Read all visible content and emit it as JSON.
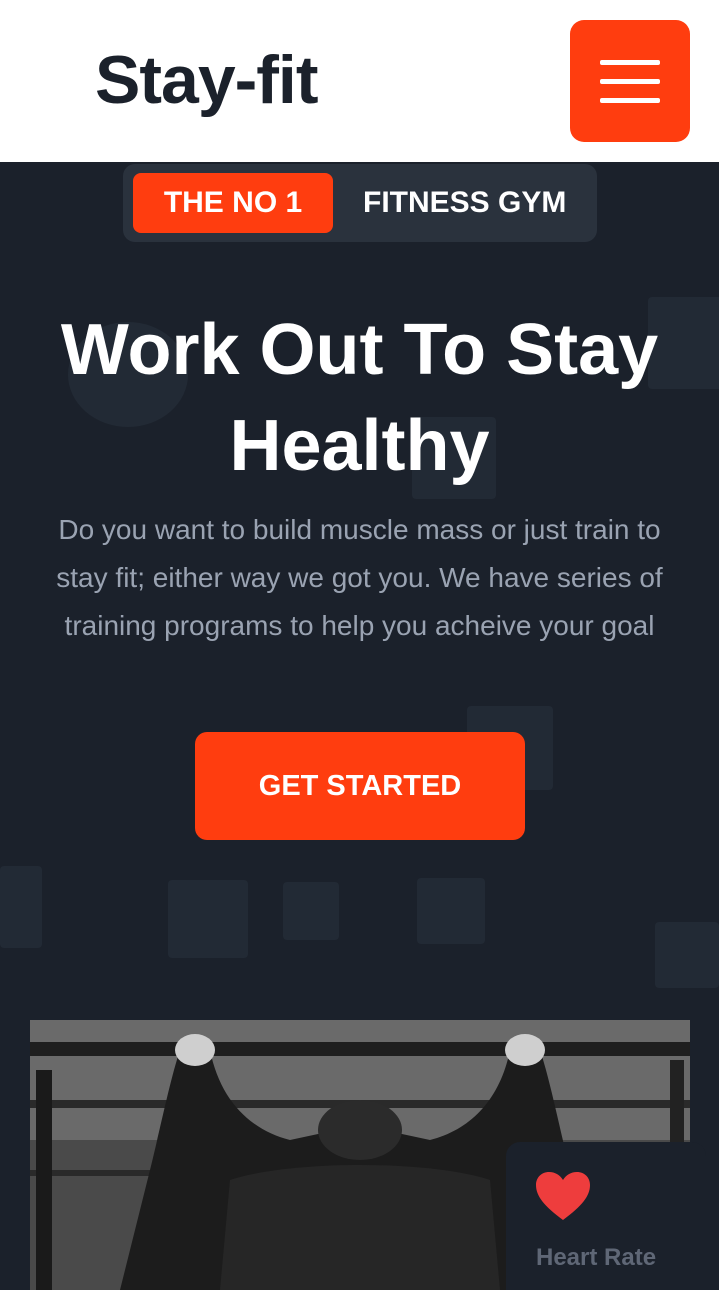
{
  "header": {
    "logo": "Stay-fit",
    "menu_icon": "hamburger-menu-icon"
  },
  "hero": {
    "tag_highlight": "THE NO 1",
    "tag_rest": "FITNESS GYM",
    "title": "Work Out To Stay Healthy",
    "description": "Do you want to build muscle mass or just train to stay fit; either way we got you. We have series of training programs to help you acheive your goal",
    "cta_label": "GET STARTED"
  },
  "widget": {
    "icon": "heart-icon",
    "label": "Heart Rate"
  },
  "colors": {
    "accent": "#ff3d0f",
    "dark_bg": "#1b212b",
    "text_muted": "#9aa3b2"
  }
}
